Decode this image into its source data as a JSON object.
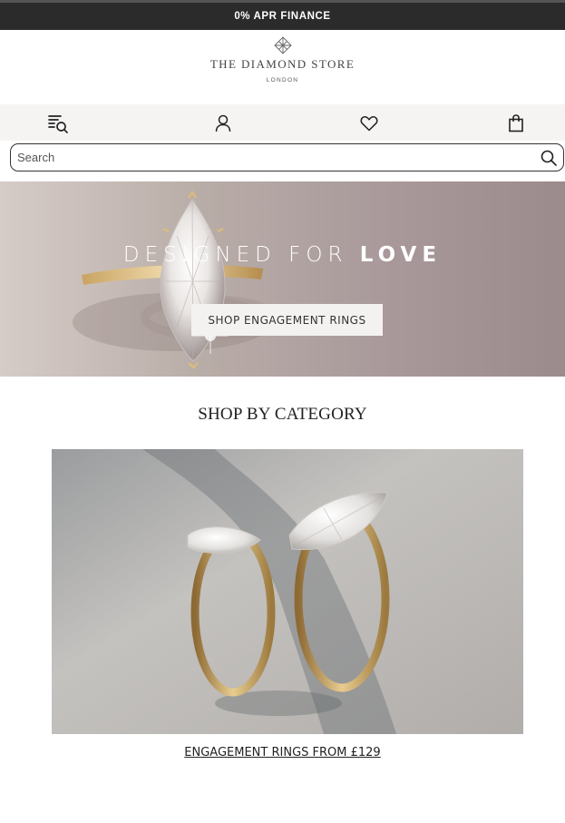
{
  "promo": {
    "text": "0% APR FINANCE"
  },
  "logo": {
    "name": "THE DIAMOND STORE",
    "location": "LONDON",
    "icon": "diamond-logo-icon"
  },
  "nav_icons": [
    {
      "name": "menu-search-icon",
      "label": ""
    },
    {
      "name": "account-icon",
      "label": ""
    },
    {
      "name": "wishlist-heart-icon",
      "label": ""
    },
    {
      "name": "shopping-bag-icon",
      "label": ""
    }
  ],
  "search": {
    "placeholder": "Search",
    "value": "",
    "icon": "search-icon"
  },
  "hero": {
    "title_regular": "DESIGNED FOR ",
    "title_bold": "LOVE",
    "cta_label": "SHOP ENGAGEMENT RINGS"
  },
  "category_section": {
    "title": "SHOP BY CATEGORY",
    "items": [
      {
        "link_label": "ENGAGEMENT RINGS FROM £129"
      }
    ]
  },
  "colors": {
    "promo_bg": "#2b2b2b",
    "icon_bar_bg": "#f6f4f3",
    "gold": "#c9a463",
    "text": "#222222"
  }
}
